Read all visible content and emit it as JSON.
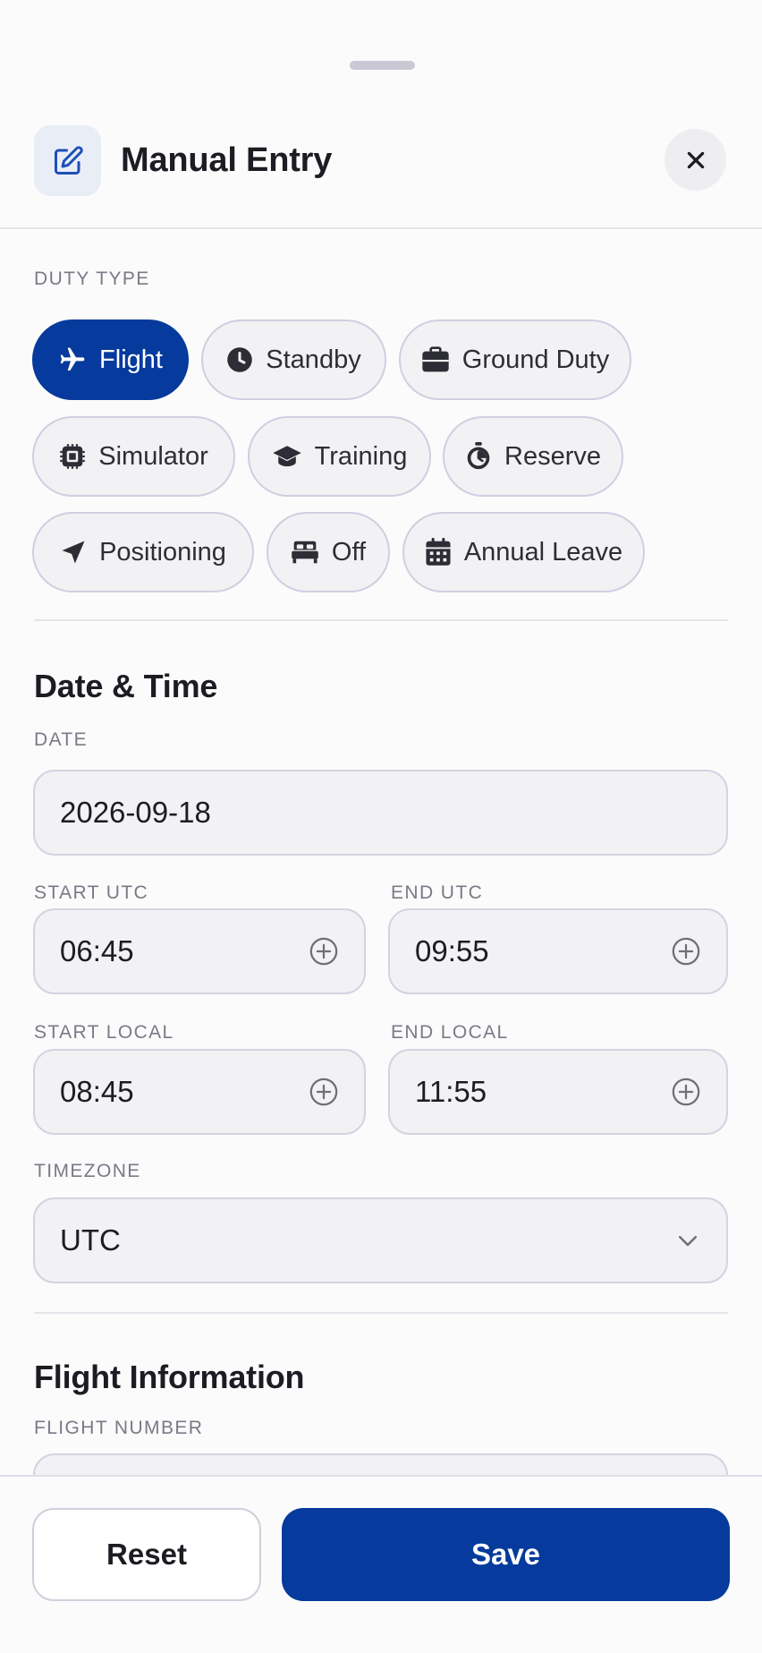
{
  "header": {
    "title": "Manual Entry",
    "icon": "edit-icon",
    "close_icon": "close-icon"
  },
  "duty_type": {
    "label": "DUTY TYPE",
    "selected": "Flight",
    "options": [
      {
        "label": "Flight",
        "icon": "airplane-icon"
      },
      {
        "label": "Standby",
        "icon": "clock-icon"
      },
      {
        "label": "Ground Duty",
        "icon": "briefcase-icon"
      },
      {
        "label": "Simulator",
        "icon": "chip-icon"
      },
      {
        "label": "Training",
        "icon": "graduation-cap-icon"
      },
      {
        "label": "Reserve",
        "icon": "stopwatch-icon"
      },
      {
        "label": "Positioning",
        "icon": "navigation-arrow-icon"
      },
      {
        "label": "Off",
        "icon": "bed-icon"
      },
      {
        "label": "Annual Leave",
        "icon": "calendar-icon"
      }
    ]
  },
  "date_time": {
    "title": "Date & Time",
    "date_label": "DATE",
    "date_value": "2026-09-18",
    "start_utc_label": "START UTC",
    "start_utc_value": "06:45",
    "end_utc_label": "END UTC",
    "end_utc_value": "09:55",
    "start_local_label": "START LOCAL",
    "start_local_value": "08:45",
    "end_local_label": "END LOCAL",
    "end_local_value": "11:55",
    "timezone_label": "TIMEZONE",
    "timezone_value": "UTC"
  },
  "flight_info": {
    "title": "Flight Information",
    "flight_number_label": "FLIGHT NUMBER"
  },
  "footer": {
    "reset_label": "Reset",
    "save_label": "Save"
  },
  "colors": {
    "accent": "#063a9c",
    "chip_bg": "#f2f2f5",
    "border": "#cfcfe0"
  }
}
